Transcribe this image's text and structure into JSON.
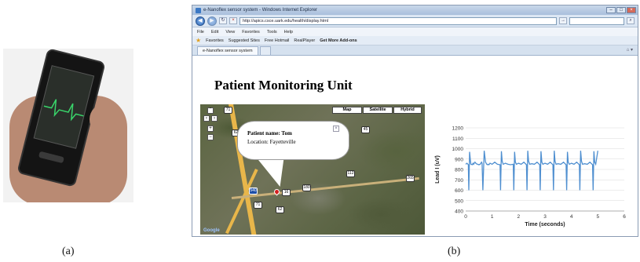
{
  "captions": {
    "left": "(a)",
    "right": "(b)"
  },
  "browser": {
    "window_title": "e-Nanoflex sensor system - Windows Internet Explorer",
    "address": "http://apics.csce.uark.edu/health/display.html",
    "menu": [
      "File",
      "Edit",
      "View",
      "Favorites",
      "Tools",
      "Help"
    ],
    "favorites": [
      "Favorites",
      "Suggested Sites",
      "Free Hotmail",
      "RealPlayer",
      "Get More Add-ons"
    ],
    "tab_label": "e-Nanoflex sensor system",
    "nav_icons": [
      "back-icon",
      "forward-icon",
      "refresh-icon",
      "stop-icon"
    ]
  },
  "page": {
    "title": "Patient Monitoring Unit"
  },
  "map": {
    "map_types": [
      "Map",
      "Satellite",
      "Hybrid"
    ],
    "zoom": [
      "+",
      "−"
    ],
    "info_window": {
      "name_line": "Patient name: Tom",
      "location_line": "Location: Fayetteville"
    },
    "shields": [
      "71",
      "62",
      "45",
      "16",
      "180",
      "112",
      "265",
      "540",
      "71",
      "62"
    ],
    "logo": "Google"
  },
  "chart_data": {
    "type": "line",
    "xlabel": "Time (seconds)",
    "ylabel": "Lead I (uV)",
    "xlim": [
      0,
      6
    ],
    "ylim": [
      400,
      1200
    ],
    "xticks": [
      0,
      1,
      2,
      3,
      4,
      5,
      6
    ],
    "yticks": [
      400,
      500,
      600,
      700,
      800,
      900,
      1000,
      1100,
      1200
    ],
    "grid": true,
    "color": "#4f8fd0",
    "x": [
      0,
      0.05,
      0.1,
      0.12,
      0.15,
      0.18,
      0.2,
      0.25,
      0.28,
      0.3,
      0.35,
      0.4,
      0.5,
      0.55,
      0.6,
      0.62,
      0.65,
      0.7,
      0.75,
      0.8,
      0.82,
      0.85,
      0.88,
      0.92,
      1.0,
      1.1,
      1.2,
      1.3,
      1.32,
      1.35,
      1.38,
      1.42,
      1.5,
      1.6,
      1.7,
      1.8,
      1.82,
      1.85,
      1.88,
      1.92,
      2.0,
      2.1,
      2.2,
      2.3,
      2.32,
      2.35,
      2.38,
      2.42,
      2.5,
      2.6,
      2.7,
      2.8,
      2.82,
      2.85,
      2.88,
      2.92,
      3.0,
      3.1,
      3.2,
      3.3,
      3.32,
      3.35,
      3.38,
      3.42,
      3.5,
      3.6,
      3.7,
      3.8,
      3.82,
      3.85,
      3.88,
      3.92,
      4.0,
      4.1,
      4.2,
      4.3,
      4.32,
      4.35,
      4.38,
      4.42,
      4.5,
      4.6,
      4.7,
      4.8,
      4.82,
      4.85,
      4.88,
      4.92,
      5.0
    ],
    "y": [
      850,
      860,
      845,
      600,
      970,
      880,
      850,
      845,
      860,
      850,
      870,
      855,
      845,
      850,
      870,
      860,
      600,
      980,
      870,
      850,
      845,
      850,
      845,
      860,
      850,
      870,
      850,
      845,
      600,
      975,
      880,
      850,
      860,
      850,
      845,
      850,
      600,
      970,
      870,
      850,
      860,
      850,
      870,
      845,
      600,
      980,
      880,
      850,
      855,
      850,
      870,
      845,
      600,
      975,
      870,
      850,
      860,
      850,
      870,
      845,
      600,
      980,
      880,
      850,
      855,
      850,
      870,
      845,
      600,
      970,
      870,
      850,
      860,
      850,
      870,
      845,
      600,
      980,
      880,
      850,
      855,
      850,
      870,
      845,
      600,
      975,
      870,
      850,
      980
    ]
  }
}
